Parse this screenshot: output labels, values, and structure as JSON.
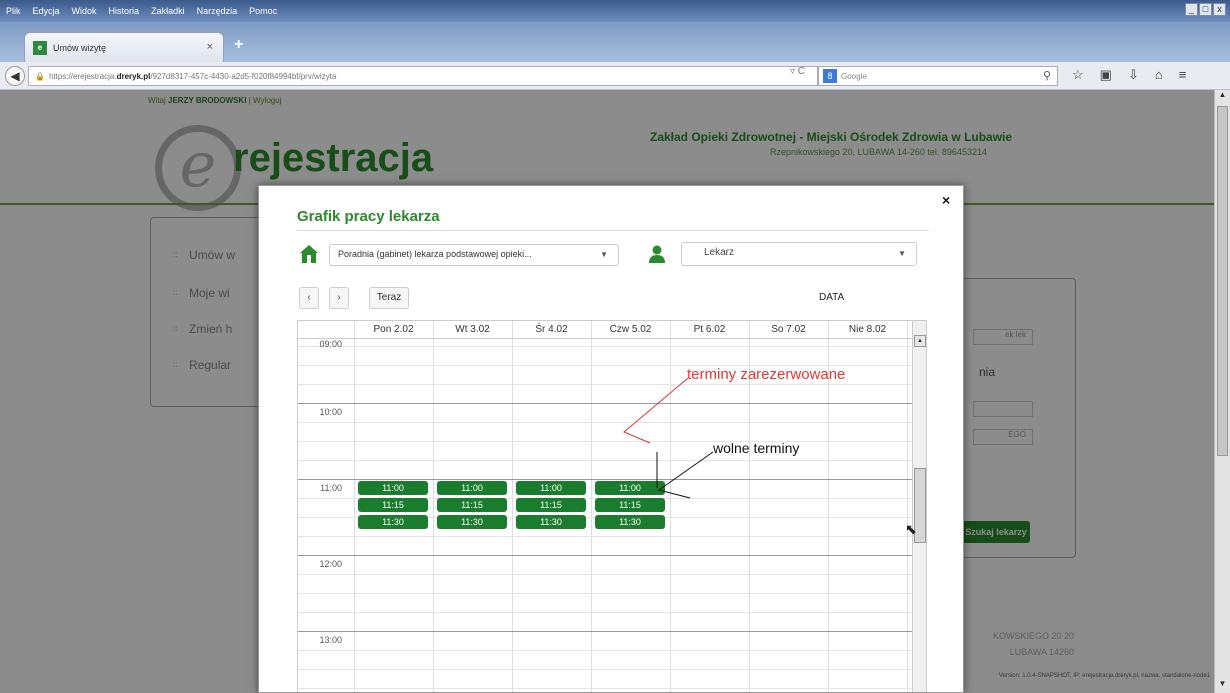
{
  "browser": {
    "menu": [
      "Plik",
      "Edycja",
      "Widok",
      "Historia",
      "Zakładki",
      "Narzędzia",
      "Pomoc"
    ],
    "window_controls": [
      "_",
      "□",
      "x"
    ],
    "tab": {
      "favicon": "e",
      "title": "Umów wizytę",
      "close": "×"
    },
    "new_tab": "+",
    "url_prefix": "https://erejestracja.",
    "url_domain": "dreryk.pl",
    "url_suffix": "/927d8317-457c-4430-a2d5-f020f84994bf/prv/wizyta",
    "search": {
      "engine_badge": "8",
      "placeholder": "Google"
    },
    "toolbar_icons": [
      "star-icon",
      "clipboard-icon",
      "download-icon",
      "home-icon",
      "menu-icon"
    ]
  },
  "page": {
    "welcome_prefix": "Witaj",
    "user_name": "JERZY BRODOWSKI",
    "logout": "Wyloguj",
    "logo_letter": "e",
    "logo_text": "rejestracja",
    "clinic_name": "Zakład Opieki Zdrowotnej - Miejski Ośrodek Zdrowia w Lubawie",
    "clinic_address": "Rzepnikowskiego 20, LUBAWA 14-260     tel. 896453214",
    "side_menu": [
      "Umów w",
      "Moje wi",
      "Zmień h",
      "Regular"
    ],
    "right_panel_select_1": "ek lek",
    "right_panel_select_2": "",
    "right_panel_select_3": "EGO",
    "right_panel_text": "nia",
    "find_doctor_button": "Szukaj lekarzy",
    "footer_address_1": "KOWSKIEGO 20 20",
    "footer_address_2": "LUBAWA 14260",
    "version": "Version: 1.0.4-SNAPSHOT, IP: erejestracja.dreryk.pl, nazwa: standalone-node1"
  },
  "modal": {
    "close": "×",
    "title": "Grafik pracy lekarza",
    "clinic_select": "Poradnia (gabinet) lekarza podstawowej opieki...",
    "doctor_select": "Lekarz",
    "today_button": "Teraz",
    "prev_button": "‹",
    "next_button": "›",
    "date_label": "DATA",
    "days": [
      "Pon 2.02",
      "Wt 3.02",
      "Śr 4.02",
      "Czw 5.02",
      "Pt 6.02",
      "So 7.02",
      "Nie 8.02"
    ],
    "times": [
      "09:00",
      "10:00",
      "11:00",
      "12:00",
      "13:00"
    ],
    "slots": [
      {
        "day": "Pon 2.02",
        "times": [
          "11:00",
          "11:15",
          "11:30"
        ]
      },
      {
        "day": "Wt 3.02",
        "times": [
          "11:00",
          "11:15",
          "11:30"
        ]
      },
      {
        "day": "Śr 4.02",
        "times": [
          "11:00",
          "11:15",
          "11:30"
        ]
      },
      {
        "day": "Czw 5.02",
        "times": [
          "11:00",
          "11:15",
          "11:30"
        ]
      }
    ]
  },
  "annotations": {
    "reserved": "terminy zarezerwowane",
    "free": "wolne terminy",
    "reserved_color": "#e33333",
    "free_color": "#111111"
  },
  "colors": {
    "brand_green": "#2c8a2c",
    "slot_green": "#1a7d2e"
  }
}
